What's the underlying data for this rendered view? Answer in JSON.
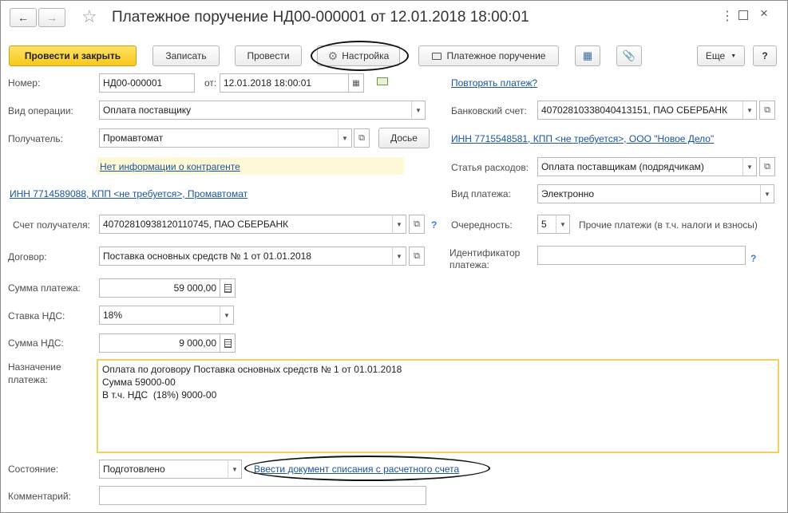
{
  "header": {
    "title": "Платежное поручение НД00-000001 от 12.01.2018 18:00:01"
  },
  "toolbar": {
    "post_close": "Провести и закрыть",
    "save": "Записать",
    "post": "Провести",
    "settings": "Настройка",
    "print": "Платежное поручение",
    "more": "Еще",
    "help": "?"
  },
  "form": {
    "number_label": "Номер:",
    "number": "НД00-000001",
    "date_label": "от:",
    "date": "12.01.2018 18:00:01",
    "repeat_link": "Повторять платеж?",
    "operation_label": "Вид операции:",
    "operation": "Оплата поставщику",
    "bank_account_label": "Банковский счет:",
    "bank_account": "40702810338040413151, ПАО СБЕРБАНК",
    "recipient_label": "Получатель:",
    "recipient": "Промавтомат",
    "dossier": "Досье",
    "org_inn_link": "ИНН 7715548581, КПП <не требуется>, ООО \"Новое Дело\"",
    "no_info_link": "Нет информации о контрагенте",
    "expense_label": "Статья расходов:",
    "expense": "Оплата поставщикам (подрядчикам)",
    "recipient_inn_link": "ИНН 7714589088, КПП <не требуется>, Промавтомат",
    "payment_type_label": "Вид платежа:",
    "payment_type": "Электронно",
    "recipient_account_label": "Счет получателя:",
    "recipient_account": "40702810938120110745, ПАО СБЕРБАНК",
    "priority_label": "Очередность:",
    "priority": "5",
    "priority_desc": "Прочие платежи (в т.ч. налоги и взносы)",
    "contract_label": "Договор:",
    "contract": "Поставка основных средств № 1 от 01.01.2018",
    "payment_id_label_1": "Идентификатор",
    "payment_id_label_2": "платежа:",
    "payment_id": "",
    "amount_label": "Сумма платежа:",
    "amount": "59 000,00",
    "vat_rate_label": "Ставка НДС:",
    "vat_rate": "18%",
    "vat_amount_label": "Сумма НДС:",
    "vat_amount": "9 000,00",
    "purpose_label_1": "Назначение",
    "purpose_label_2": "платежа:",
    "purpose": "Оплата по договору Поставка основных средств № 1 от 01.01.2018\nСумма 59000-00\nВ т.ч. НДС  (18%) 9000-00",
    "state_label": "Состояние:",
    "state": "Подготовлено",
    "write_off_link": "Ввести документ списания с расчетного счета",
    "comment_label": "Комментарий:",
    "comment": ""
  },
  "colors": {
    "primary_button": "#f8c81b",
    "link": "#1a55a0",
    "highlight_bg": "#fdf8d6",
    "active_border": "#f0d060"
  }
}
